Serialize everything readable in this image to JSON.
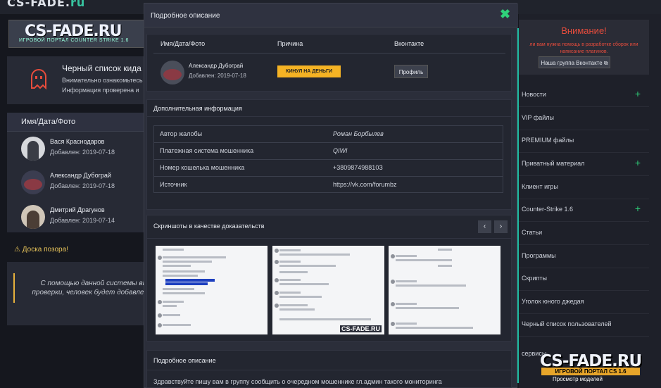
{
  "site": {
    "top_logo_a": "CS-FADE.",
    "top_logo_b": "ru",
    "logo_text": "CS-FADE.RU",
    "logo_sub": "ИГРОВОЙ ПОРТАЛ COUNTER STRIKE 1.6"
  },
  "blacklist": {
    "title": "Черный список кида",
    "desc_1": "Внимательно ознакомьтесь",
    "desc_2": "Информация проверена и"
  },
  "list": {
    "header": "Имя/Дата/Фото",
    "rows": [
      {
        "name": "Вася Краснодаров",
        "date": "Добавлен: 2019-07-18"
      },
      {
        "name": "Александр Дубограй",
        "date": "Добавлен: 2019-07-18"
      },
      {
        "name": "Дмитрий Драгунов",
        "date": "Добавлен: 2019-07-14"
      }
    ]
  },
  "shame": {
    "title": "⚠ Доска позора!",
    "text_1": "С помощью данной системы вы",
    "text_2": "проверки, человек будет добавлен"
  },
  "sidebar": {
    "alert_title": "Внимание!",
    "alert_text": "ли вам нужна помощь в разработке сборок или написание плагинов.",
    "alert_button": "Наша группа Вконтакте ⧉",
    "items": [
      {
        "label": "Новости",
        "plus": "+"
      },
      {
        "label": "VIP файлы",
        "plus": ""
      },
      {
        "label": "PREMIUM файлы",
        "plus": ""
      },
      {
        "label": "Приватный материал",
        "plus": "+"
      },
      {
        "label": "Клиент игры",
        "plus": ""
      },
      {
        "label": "Counter-Strike 1.6",
        "plus": "+"
      },
      {
        "label": "Статьи",
        "plus": ""
      },
      {
        "label": "Программы",
        "plus": ""
      },
      {
        "label": "Скрипты",
        "plus": ""
      },
      {
        "label": "Уголок юного джедая",
        "plus": ""
      },
      {
        "label": "Черный список пользователей",
        "plus": ""
      }
    ],
    "services": "сервисы",
    "bottom_logo": "CS-FADE.RU",
    "bottom_sub": "ИГРОВОЙ ПОРТАЛ CS 1.6",
    "bottom_link": "Просмотр моделей"
  },
  "modal": {
    "title": "Подробное описание",
    "close": "✖",
    "col_name": "Имя/Дата/Фото",
    "col_reason": "Причина",
    "col_vk": "Вконтакте",
    "person_name": "Александр Дубограй",
    "person_date": "Добавлен: 2019-07-18",
    "reason_badge": "КИНУЛ НА ДЕНЬГИ",
    "profile_button": "Профиль",
    "info_title": "Дополнительная информация",
    "info_rows": [
      {
        "key": "Автор жалобы",
        "value": "Роман Борбылев"
      },
      {
        "key": "Платежная система мошенника",
        "value": "QIWI"
      },
      {
        "key": "Номер кошелька мошенника",
        "value": "+380987498810З"
      },
      {
        "key": "Источник",
        "value": "https://vk.com/forumbz"
      }
    ],
    "screens_title": "Скриншоты в качестве доказательств",
    "prev": "‹",
    "next": "›",
    "watermark": "CS-FADE.RU",
    "desc_title": "Подробное описание",
    "desc_text": "Здравствуйте пишу вам в группу сообщить о очередном мошеннике гл.админ такого мониторинга"
  }
}
